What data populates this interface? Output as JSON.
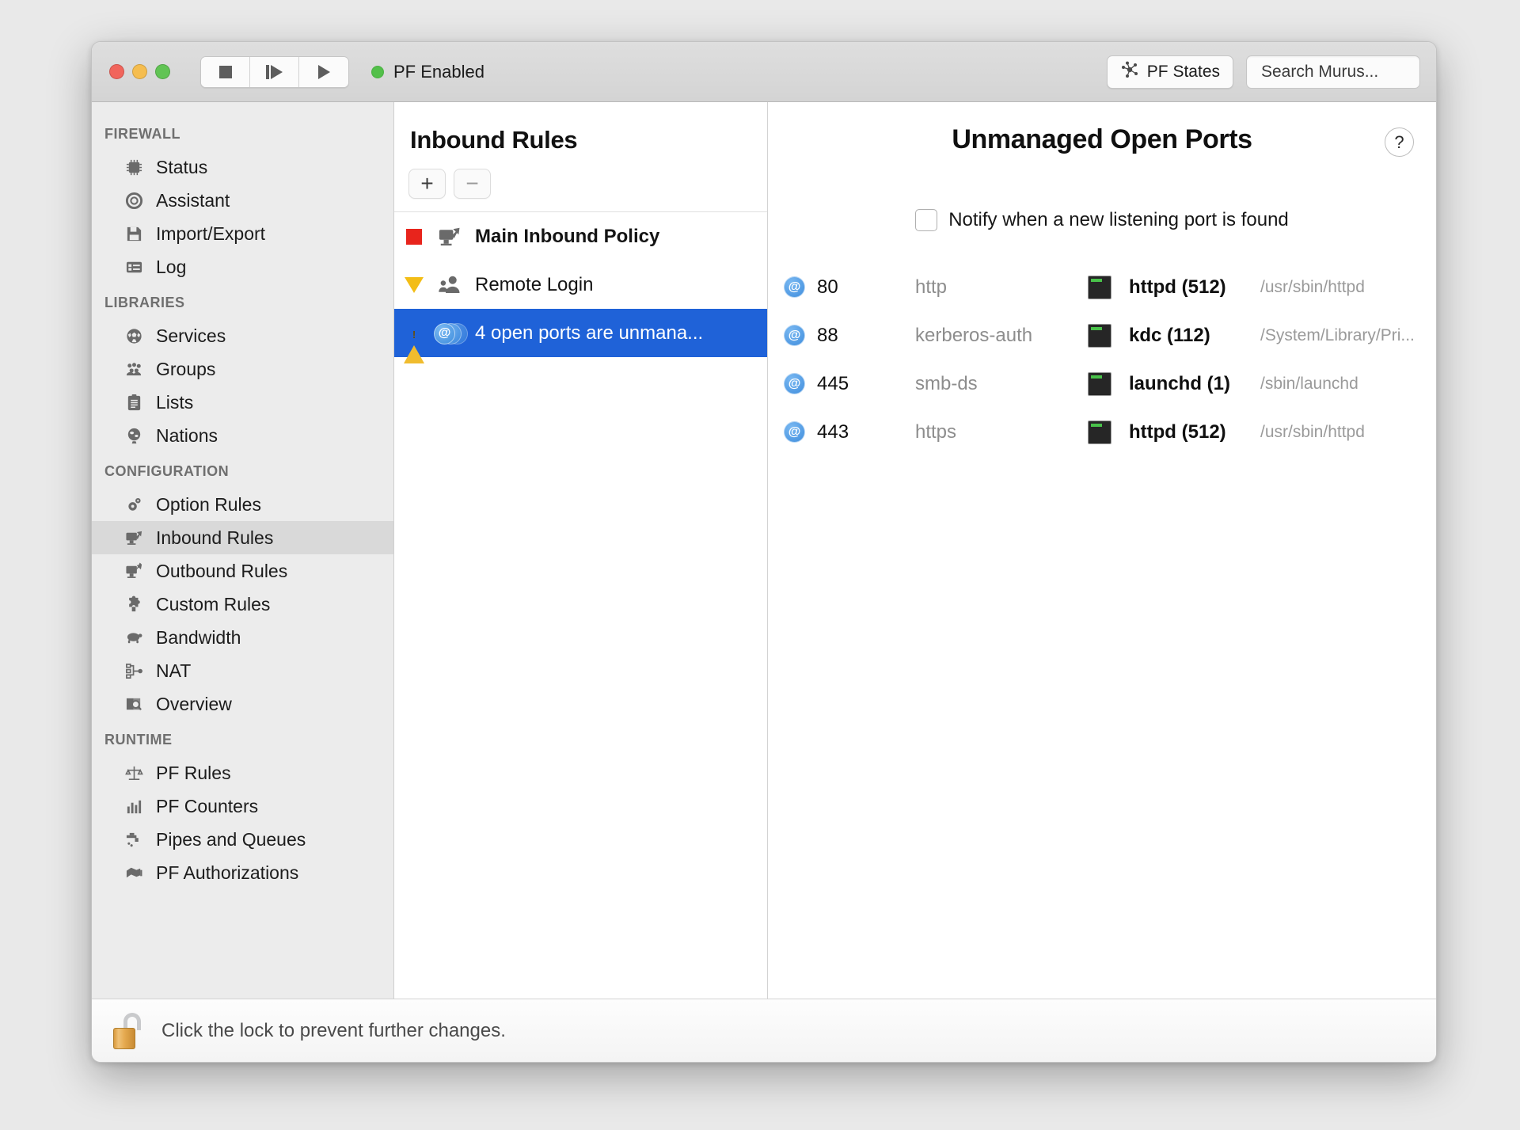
{
  "titlebar": {
    "status_label": "PF Enabled",
    "pf_states_label": "PF States",
    "search_placeholder": "Search Murus...",
    "traffic_lights": [
      "close",
      "minimize",
      "zoom"
    ],
    "transport": [
      "stop",
      "step",
      "play"
    ],
    "status_color": "#53c04a"
  },
  "sidebar": {
    "sections": [
      {
        "header": "FIREWALL",
        "items": [
          {
            "label": "Status",
            "icon": "chip-icon",
            "selected": false
          },
          {
            "label": "Assistant",
            "icon": "lifering-icon",
            "selected": false
          },
          {
            "label": "Import/Export",
            "icon": "floppy-icon",
            "selected": false
          },
          {
            "label": "Log",
            "icon": "log-icon",
            "selected": false
          }
        ]
      },
      {
        "header": "LIBRARIES",
        "items": [
          {
            "label": "Services",
            "icon": "ball-icon",
            "selected": false
          },
          {
            "label": "Groups",
            "icon": "people-icon",
            "selected": false
          },
          {
            "label": "Lists",
            "icon": "clipboard-icon",
            "selected": false
          },
          {
            "label": "Nations",
            "icon": "globe-icon",
            "selected": false
          }
        ]
      },
      {
        "header": "CONFIGURATION",
        "items": [
          {
            "label": "Option Rules",
            "icon": "gears-icon",
            "selected": false
          },
          {
            "label": "Inbound Rules",
            "icon": "inbound-arrow-icon",
            "selected": true
          },
          {
            "label": "Outbound Rules",
            "icon": "outbound-arrow-icon",
            "selected": false
          },
          {
            "label": "Custom Rules",
            "icon": "puzzle-icon",
            "selected": false
          },
          {
            "label": "Bandwidth",
            "icon": "turtle-icon",
            "selected": false
          },
          {
            "label": "NAT",
            "icon": "network-tree-icon",
            "selected": false
          },
          {
            "label": "Overview",
            "icon": "magnifier-book-icon",
            "selected": false
          }
        ]
      },
      {
        "header": "RUNTIME",
        "items": [
          {
            "label": "PF Rules",
            "icon": "scales-icon",
            "selected": false
          },
          {
            "label": "PF Counters",
            "icon": "barchart-icon",
            "selected": false
          },
          {
            "label": "Pipes and Queues",
            "icon": "faucet-icon",
            "selected": false
          },
          {
            "label": "PF Authorizations",
            "icon": "handshake-icon",
            "selected": false
          }
        ]
      }
    ]
  },
  "middle": {
    "title": "Inbound Rules",
    "add_label": "+",
    "remove_label": "−",
    "rules": [
      {
        "label": "Main Inbound Policy",
        "marker": "red-square-marker",
        "icon": "inbound-arrow-icon",
        "bold": true,
        "selected": false
      },
      {
        "label": "Remote Login",
        "marker": "yellow-triangle-marker",
        "icon": "remote-login-icon",
        "bold": false,
        "selected": false
      },
      {
        "label": "4 open ports are unmana...",
        "marker": "warning-triangle-marker",
        "icon": "at-stack-icon",
        "bold": false,
        "selected": true
      }
    ],
    "selection_color": "#1f62d8"
  },
  "right": {
    "title": "Unmanaged Open Ports",
    "help_label": "?",
    "notify": {
      "label": "Notify when a new listening port is found",
      "checked": false
    },
    "ports": [
      {
        "at": "@",
        "port": "80",
        "service": "http",
        "process": "httpd (512)",
        "path": "/usr/sbin/httpd"
      },
      {
        "at": "@",
        "port": "88",
        "service": "kerberos-auth",
        "process": "kdc (112)",
        "path": "/System/Library/Pri..."
      },
      {
        "at": "@",
        "port": "445",
        "service": "smb-ds",
        "process": "launchd (1)",
        "path": "/sbin/launchd"
      },
      {
        "at": "@",
        "port": "443",
        "service": "https",
        "process": "httpd (512)",
        "path": "/usr/sbin/httpd"
      }
    ]
  },
  "footer": {
    "lock_text": "Click the lock to prevent further changes.",
    "lock_state": "unlocked"
  }
}
